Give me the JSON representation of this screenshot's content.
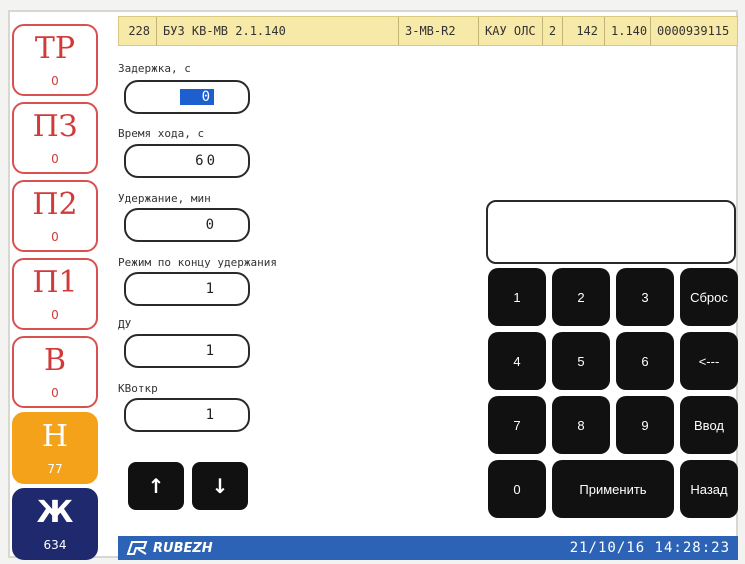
{
  "status_tiles": [
    {
      "code": "ТР",
      "count": "0"
    },
    {
      "code": "ПЗ",
      "count": "0"
    },
    {
      "code": "П2",
      "count": "0"
    },
    {
      "code": "П1",
      "count": "0"
    },
    {
      "code": "В",
      "count": "0"
    },
    {
      "code": "Н",
      "count": "77"
    },
    {
      "code": "Ж",
      "count": "634"
    }
  ],
  "header": {
    "num": "228",
    "device": "БУЗ КВ-МВ 2.1.140",
    "type": "З-МВ-R2",
    "panel": "КАУ ОЛС",
    "panel_num": "2",
    "id": "142",
    "version": "1.140",
    "serial": "0000939115"
  },
  "params": [
    {
      "label": "Задержка, с",
      "value": "0"
    },
    {
      "label": "Время хода, с",
      "value": "60"
    },
    {
      "label": "Удержание, мин",
      "value": "0"
    },
    {
      "label": "Режим по концу удержания",
      "value": "1"
    },
    {
      "label": "ДУ",
      "value": "1"
    },
    {
      "label": "КВоткр",
      "value": "1"
    }
  ],
  "arrows": {
    "up": "↑",
    "down": "↓"
  },
  "keypad": {
    "k1": "1",
    "k2": "2",
    "k3": "3",
    "reset": "Сброс",
    "k4": "4",
    "k5": "5",
    "k6": "6",
    "backspace": "<---",
    "k7": "7",
    "k8": "8",
    "k9": "9",
    "enter": "Ввод",
    "k0": "0",
    "apply": "Применить",
    "back": "Назад"
  },
  "footer": {
    "brand": "RUBEZH",
    "datetime": "21/10/16  14:28:23"
  },
  "colors": {
    "alarm_red": "#d23a3a",
    "warning_orange": "#f4a21a",
    "navy": "#1f2a6e",
    "footer_blue": "#2d63b6",
    "header_yellow": "#f7e9a8"
  }
}
